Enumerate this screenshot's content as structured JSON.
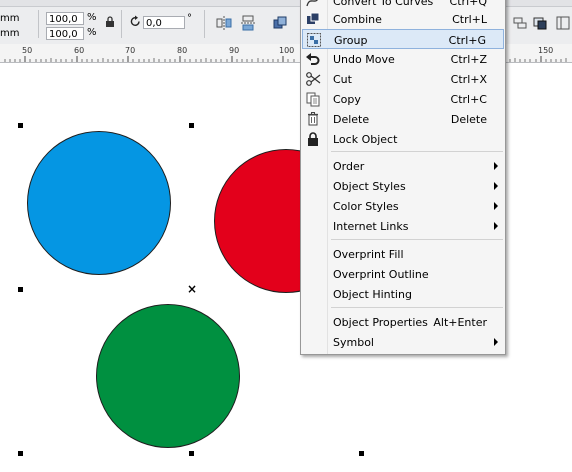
{
  "toolbar": {
    "width_unit": "mm",
    "height_unit": "mm",
    "scale_x": "100,0",
    "scale_y": "100,0",
    "percent_x": "%",
    "percent_y": "%",
    "rotation": "0,0",
    "rotation_unit": "°",
    "icons": [
      "lock-ratio-icon",
      "rotate-icon",
      "mirror-horizontal-icon",
      "mirror-vertical-icon",
      "arrange-icon"
    ]
  },
  "ruler": {
    "ticks": [
      "50",
      "60",
      "70",
      "80",
      "90",
      "100",
      "150"
    ]
  },
  "canvas": {
    "shapes": [
      {
        "name": "blue-circle",
        "color": "#0596e3"
      },
      {
        "name": "red-circle",
        "color": "#e3001b"
      },
      {
        "name": "green-circle",
        "color": "#009040"
      }
    ],
    "center_marker": "×"
  },
  "context_menu": {
    "items": [
      {
        "label": "Convert To Curves",
        "shortcut": "Ctrl+Q",
        "icon": "convert-curves-icon"
      },
      {
        "label": "Combine",
        "shortcut": "Ctrl+L",
        "icon": "combine-icon"
      },
      {
        "label": "Group",
        "shortcut": "Ctrl+G",
        "icon": "group-icon",
        "highlighted": true
      },
      {
        "label": "Undo Move",
        "shortcut": "Ctrl+Z",
        "icon": "undo-icon"
      },
      {
        "label": "Cut",
        "shortcut": "Ctrl+X",
        "icon": "cut-icon"
      },
      {
        "label": "Copy",
        "shortcut": "Ctrl+C",
        "icon": "copy-icon"
      },
      {
        "label": "Delete",
        "shortcut": "Delete",
        "icon": "delete-icon"
      },
      {
        "label": "Lock Object",
        "shortcut": "",
        "icon": "lock-icon"
      },
      {
        "label": "Order",
        "submenu": true
      },
      {
        "label": "Object Styles",
        "submenu": true
      },
      {
        "label": "Color Styles",
        "submenu": true
      },
      {
        "label": "Internet Links",
        "submenu": true
      },
      {
        "label": "Overprint Fill"
      },
      {
        "label": "Overprint Outline"
      },
      {
        "label": "Object Hinting"
      },
      {
        "label": "Object Properties",
        "shortcut": "Alt+Enter"
      },
      {
        "label": "Symbol",
        "submenu": true
      }
    ]
  }
}
